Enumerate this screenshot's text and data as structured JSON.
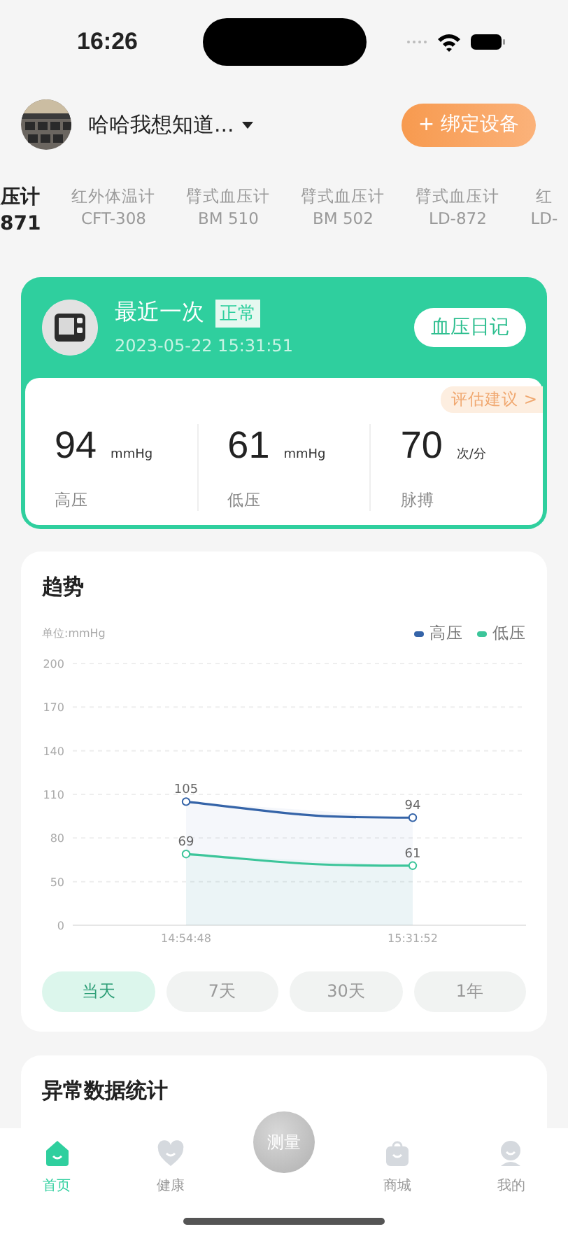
{
  "status_bar": {
    "time": "16:26"
  },
  "header": {
    "user_name": "哈哈我想知道...",
    "bind_button": "+ 绑定设备"
  },
  "devices": [
    {
      "name": "压计",
      "model": "871",
      "selected": true
    },
    {
      "name": "红外体温计",
      "model": "CFT-308",
      "selected": false
    },
    {
      "name": "臂式血压计",
      "model": "BM 510",
      "selected": false
    },
    {
      "name": "臂式血压计",
      "model": "BM 502",
      "selected": false
    },
    {
      "name": "臂式血压计",
      "model": "LD-872",
      "selected": false
    },
    {
      "name": "红",
      "model": "LD-",
      "selected": false
    }
  ],
  "latest": {
    "title": "最近一次",
    "status": "正常",
    "time": "2023-05-22 15:31:51",
    "diary_button": "血压日记",
    "advice_tag": "评估建议 >",
    "readings": [
      {
        "value": "94",
        "unit": "mmHg",
        "label": "高压"
      },
      {
        "value": "61",
        "unit": "mmHg",
        "label": "低压"
      },
      {
        "value": "70",
        "unit": "次/分",
        "label": "脉搏"
      }
    ]
  },
  "trend": {
    "title": "趋势",
    "unit": "单位:mmHg",
    "baseline_label": "0",
    "chart_data": {
      "type": "area",
      "categories": [
        "14:54:48",
        "15:31:52"
      ],
      "series": [
        {
          "name": "高压",
          "color": "#3564a8",
          "marker": "circle",
          "values": [
            105,
            94
          ]
        },
        {
          "name": "低压",
          "color": "#3cc59a",
          "marker": "circle",
          "values": [
            69,
            61
          ]
        }
      ],
      "ylim": [
        20,
        200
      ],
      "yticks": [
        50,
        80,
        110,
        140,
        170,
        200
      ],
      "grid": true,
      "data_labels": true
    },
    "ranges": [
      {
        "label": "当天",
        "selected": true
      },
      {
        "label": "7天",
        "selected": false
      },
      {
        "label": "30天",
        "selected": false
      },
      {
        "label": "1年",
        "selected": false
      }
    ]
  },
  "abnormal": {
    "title": "异常数据统计"
  },
  "tab_bar": {
    "items": [
      {
        "kind": "tab",
        "label": "首页",
        "selected": true
      },
      {
        "kind": "tab",
        "label": "健康",
        "selected": false
      },
      {
        "kind": "measure",
        "label": "测量"
      },
      {
        "kind": "tab",
        "label": "商城",
        "selected": false
      },
      {
        "kind": "tab",
        "label": "我的",
        "selected": false
      }
    ]
  }
}
